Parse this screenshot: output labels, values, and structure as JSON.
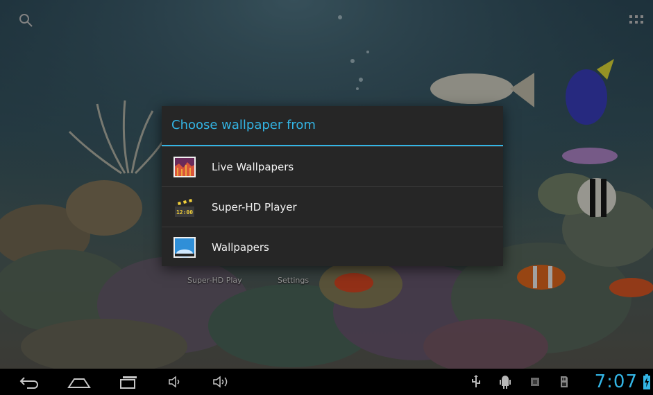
{
  "home_screen": {
    "shortcuts": [
      "Super-HD Play",
      "Settings"
    ]
  },
  "dialog": {
    "title": "Choose wallpaper from",
    "items": [
      {
        "label": "Live Wallpapers",
        "icon": "live-wallpapers-icon"
      },
      {
        "label": "Super-HD Player",
        "icon": "video-player-icon"
      },
      {
        "label": "Wallpapers",
        "icon": "wallpapers-icon"
      }
    ]
  },
  "status_bar": {
    "time": "7:07",
    "accent_color": "#33b5e5"
  }
}
